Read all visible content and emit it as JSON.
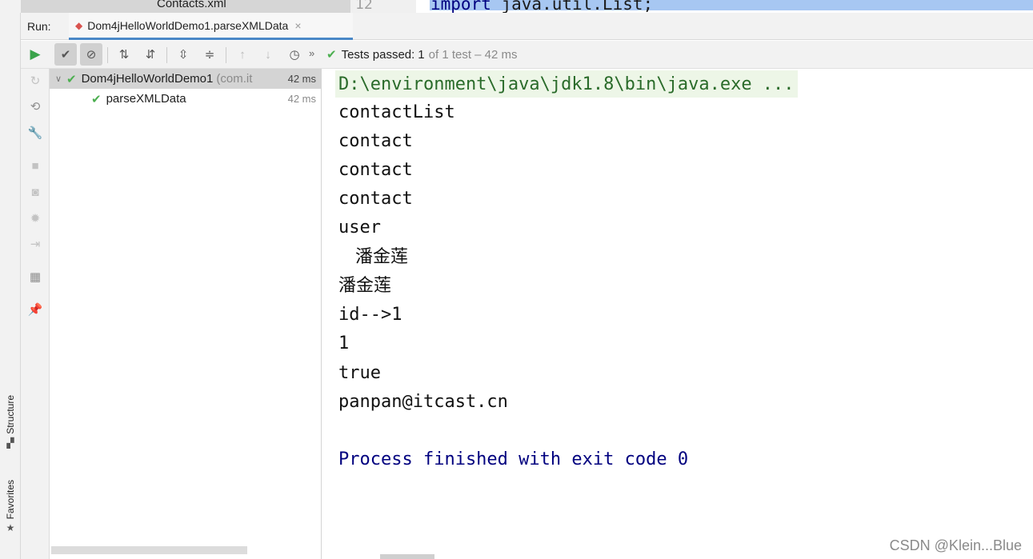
{
  "editor_sliver": {
    "project_file": "Contacts.xml",
    "line_number": "12",
    "code_keyword": "import",
    "code_rest": " java.util.List;"
  },
  "side_tabs": {
    "structure": "Structure",
    "favorites": "Favorites"
  },
  "run_panel": {
    "label": "Run:",
    "tab_title": "Dom4jHelloWorldDemo1.parseXMLData",
    "status": {
      "passed_label": "Tests passed:",
      "passed_count": "1",
      "rest": "of 1 test – 42 ms"
    }
  },
  "tree": {
    "root": {
      "name": "Dom4jHelloWorldDemo1",
      "package": "(com.it",
      "duration": "42 ms"
    },
    "child": {
      "name": "parseXMLData",
      "duration": "42 ms"
    }
  },
  "console": {
    "command": "D:\\environment\\java\\jdk1.8\\bin\\java.exe ...",
    "lines": [
      "contactList",
      "contact",
      "contact",
      "contact",
      "user",
      "   潘金莲",
      "潘金莲",
      "id-->1",
      "1",
      "true",
      "panpan@itcast.cn"
    ],
    "finish": "Process finished with exit code 0"
  },
  "watermark": "CSDN @Klein...Blue",
  "icons": {
    "tab_icon": "junit-test-icon",
    "run": "rerun-icon",
    "show_passed": "check-icon",
    "show_ignored": "ignored-icon",
    "sort_alpha": "sort-alphabetically-icon",
    "sort_duration": "sort-by-duration-icon",
    "expand_all": "expand-all-icon",
    "collapse_all": "collapse-all-icon",
    "prev_fail": "arrow-up-icon",
    "next_fail": "arrow-down-icon",
    "history": "history-icon"
  },
  "colors": {
    "accent": "#4a88c7",
    "passed_green": "#4caf50",
    "command_bg": "#edf6e7",
    "exit_text": "#00007f"
  }
}
